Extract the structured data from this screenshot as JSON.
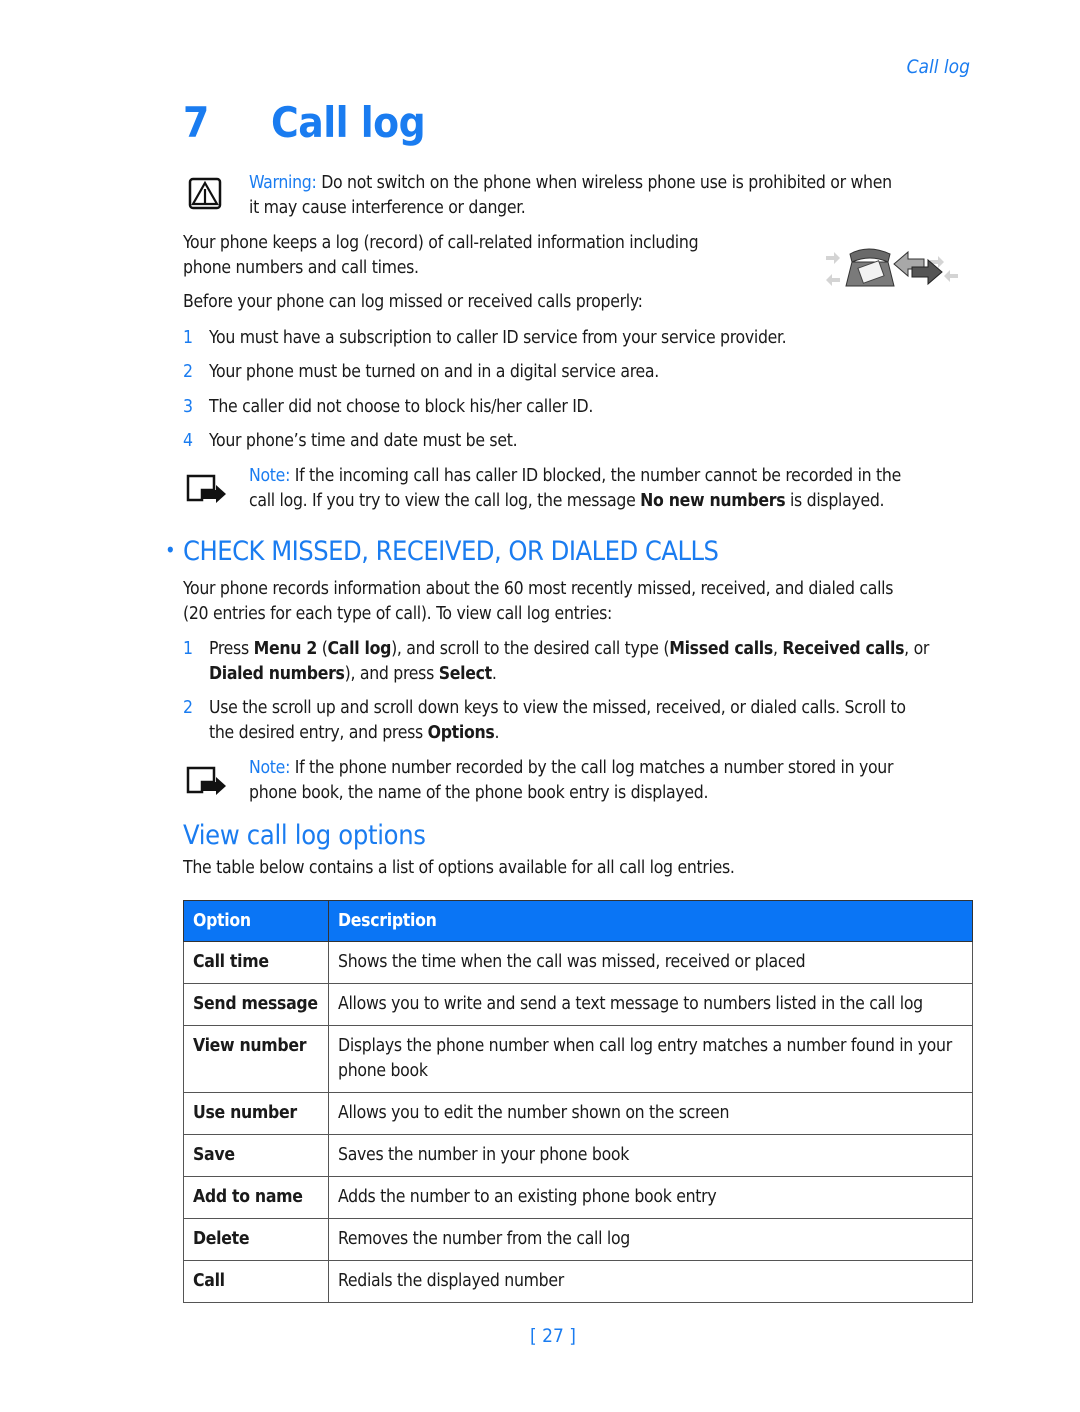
{
  "running_head": "Call log",
  "chapter": {
    "number": "7",
    "title": "Call log"
  },
  "warning": {
    "icon": "warning-triangle-icon",
    "label": "Warning:",
    "line1": "Do not switch on the phone when wireless phone use is prohibited or when",
    "line2": "it may cause interference or danger."
  },
  "intro": {
    "line1": "Your phone keeps a log (record) of call-related information including",
    "line2": "phone numbers and call times.",
    "illustration": "phone-with-arrows-icon"
  },
  "prereq_intro": "Before your phone can log missed or received calls properly:",
  "prereqs": [
    {
      "num": "1",
      "text": "You must have a subscription to caller ID service from your service provider."
    },
    {
      "num": "2",
      "text": "Your phone must be turned on and in a digital service area."
    },
    {
      "num": "3",
      "text": "The caller did not choose to block his/her caller ID."
    },
    {
      "num": "4",
      "text": "Your phone’s time and date must be set."
    }
  ],
  "note1": {
    "icon": "note-arrow-icon",
    "label": "Note:",
    "line1": "If the incoming call has caller ID blocked, the number cannot be recorded in the",
    "line2_pre": "call log. If you try to view the call log, the message ",
    "line2_bold": "No new numbers",
    "line2_post": " is displayed."
  },
  "section": {
    "bullet": "•",
    "title": "CHECK MISSED, RECEIVED, OR DIALED CALLS",
    "para_line1": "Your phone records information about the 60 most recently missed, received, and dialed calls",
    "para_line2": "(20 entries for each type of call). To view call log entries:",
    "steps": [
      {
        "num": "1",
        "l1_a": "Press ",
        "l1_b": "Menu 2",
        "l1_c": " (",
        "l1_d": "Call log",
        "l1_e": "), and scroll to the desired call type (",
        "l1_f": "Missed calls",
        "l1_g": ", ",
        "l1_h": "Received calls",
        "l1_i": ", or",
        "l2_a": "Dialed numbers",
        "l2_b": "), and press ",
        "l2_c": "Select",
        "l2_d": "."
      },
      {
        "num": "2",
        "l1": "Use the scroll up and scroll down keys to view the missed, received, or dialed calls. Scroll to",
        "l2_a": "the desired entry, and press ",
        "l2_b": "Options",
        "l2_c": "."
      }
    ],
    "note2": {
      "label": "Note:",
      "line1": "If the phone number recorded by the call log matches a number stored in your",
      "line2": "phone book, the name of the phone book entry is displayed."
    }
  },
  "subsection": {
    "title": "View call log options",
    "para": "The table below contains a list of options available for all call log entries."
  },
  "table": {
    "headers": {
      "option": "Option",
      "description": "Description"
    },
    "header_color": "#0a75f5",
    "rows": [
      {
        "option": "Call time",
        "description": "Shows the time when the call was missed, received or placed"
      },
      {
        "option": "Send message",
        "description": "Allows you to write and send a text message to numbers listed in the call log"
      },
      {
        "option": "View number",
        "description": "Displays the phone number when call log entry matches a number found in your phone book"
      },
      {
        "option": "Use number",
        "description": "Allows you to edit the number shown on the screen"
      },
      {
        "option": "Save",
        "description": "Saves the number in your phone book"
      },
      {
        "option": "Add to name",
        "description": "Adds the number to an existing phone book entry"
      },
      {
        "option": "Delete",
        "description": "Removes the number from the call log"
      },
      {
        "option": "Call",
        "description": "Redials the displayed number"
      }
    ]
  },
  "page_number": "[ 27 ]",
  "accent_color": "#1a7cf0"
}
